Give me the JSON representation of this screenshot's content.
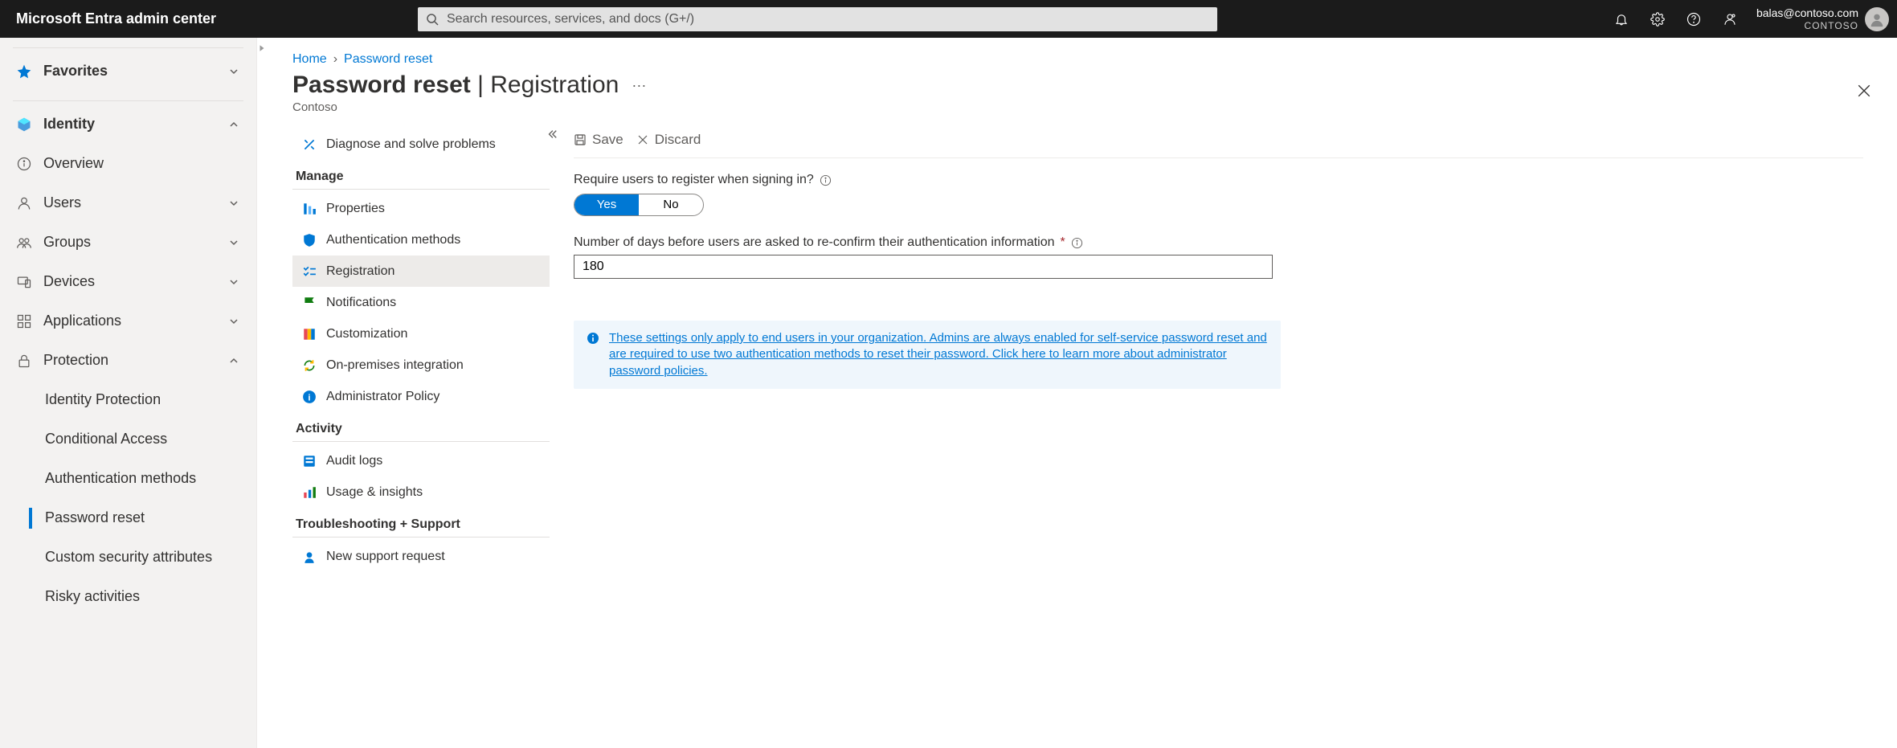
{
  "header": {
    "brand": "Microsoft Entra admin center",
    "search_placeholder": "Search resources, services, and docs (G+/)",
    "account_email": "balas@contoso.com",
    "account_tenant": "CONTOSO"
  },
  "left_nav": {
    "favorites": "Favorites",
    "identity": "Identity",
    "items": {
      "overview": "Overview",
      "users": "Users",
      "groups": "Groups",
      "devices": "Devices",
      "applications": "Applications",
      "protection": "Protection"
    },
    "protection_sub": {
      "identity_protection": "Identity Protection",
      "conditional_access": "Conditional Access",
      "auth_methods": "Authentication methods",
      "password_reset": "Password reset",
      "custom_sec_attrs": "Custom security attributes",
      "risky_activities": "Risky activities"
    }
  },
  "breadcrumb": {
    "home": "Home",
    "current": "Password reset"
  },
  "blade": {
    "title_main": "Password reset",
    "title_sep": "|",
    "title_sub": "Registration",
    "subtitle": "Contoso",
    "more": "···"
  },
  "blade_nav": {
    "diagnose": "Diagnose and solve problems",
    "manage_heading": "Manage",
    "properties": "Properties",
    "auth_methods": "Authentication methods",
    "registration": "Registration",
    "notifications": "Notifications",
    "customization": "Customization",
    "onprem": "On-premises integration",
    "admin_policy": "Administrator Policy",
    "activity_heading": "Activity",
    "audit_logs": "Audit logs",
    "usage": "Usage & insights",
    "troubleshooting_heading": "Troubleshooting + Support",
    "new_support": "New support request"
  },
  "toolbar": {
    "save": "Save",
    "discard": "Discard"
  },
  "form": {
    "require_register_label": "Require users to register when signing in?",
    "yes": "Yes",
    "no": "No",
    "days_label": "Number of days before users are asked to re-confirm their authentication information",
    "days_value": "180"
  },
  "banner": {
    "text": "These settings only apply to end users in your organization. Admins are always enabled for self-service password reset and are required to use two authentication methods to reset their password. Click here to learn more about administrator password policies."
  }
}
